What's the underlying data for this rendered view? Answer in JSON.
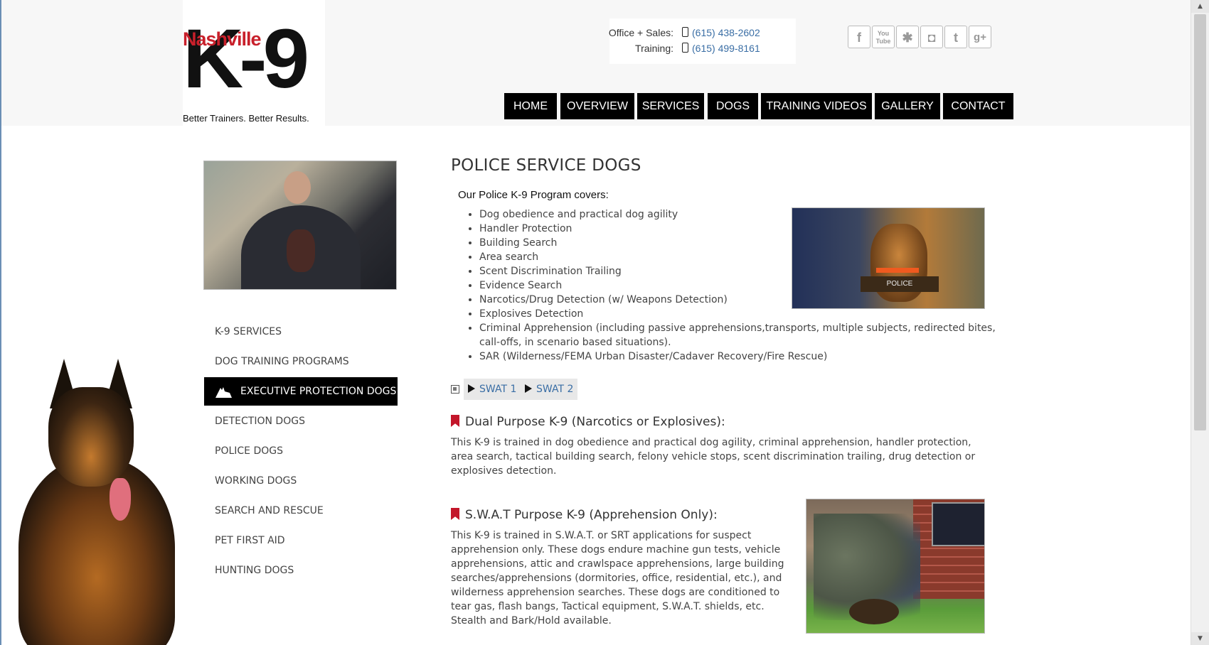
{
  "brand": {
    "name_top": "Nashville",
    "name_main": "K-9",
    "tagline": "Better Trainers. Better Results."
  },
  "contact": {
    "office_label": "Office + Sales:",
    "office_phone": "(615) 438-2602",
    "training_label": "Training:",
    "training_phone": "(615) 499-8161"
  },
  "social": [
    {
      "name": "facebook",
      "glyph": "f"
    },
    {
      "name": "youtube",
      "glyph": "You Tube"
    },
    {
      "name": "yelp",
      "glyph": "✱"
    },
    {
      "name": "instagram",
      "glyph": "◘"
    },
    {
      "name": "twitter",
      "glyph": "t"
    },
    {
      "name": "google-plus",
      "glyph": "g+"
    }
  ],
  "nav": [
    "HOME",
    "OVERVIEW",
    "SERVICES",
    "DOGS",
    "TRAINING VIDEOS",
    "GALLERY",
    "CONTACT"
  ],
  "sidenav": [
    "K-9 SERVICES",
    "DOG TRAINING PROGRAMS",
    "EXECUTIVE PROTECTION DOGS",
    "DETECTION DOGS",
    "POLICE DOGS",
    "WORKING DOGS",
    "SEARCH AND RESCUE",
    "PET FIRST AID",
    "HUNTING DOGS"
  ],
  "sidenav_active": "EXECUTIVE PROTECTION DOGS",
  "page": {
    "title": "POLICE SERVICE DOGS",
    "intro": "Our Police K-9 Program covers:",
    "program_items": [
      "Dog obedience and practical dog agility",
      "Handler Protection",
      "Building Search",
      "Area search",
      "Scent Discrimination Trailing",
      "Evidence Search",
      "Narcotics/Drug Detection (w/ Weapons Detection)",
      "Explosives Detection",
      "Criminal Apprehension (including passive apprehensions,transports, multiple subjects, redirected bites, call-offs, in scenario based situations).",
      "SAR (Wilderness/FEMA Urban Disaster/Cadaver Recovery/Fire Rescue)"
    ],
    "police_photo_vest": "POLICE",
    "videos": [
      "SWAT 1",
      "SWAT 2"
    ],
    "sections": [
      {
        "title": "Dual Purpose K-9 (Narcotics or Explosives):",
        "text": "This K-9 is trained in dog obedience and practical dog agility, criminal apprehension, handler protection, area search, tactical building search, felony vehicle stops, scent discrimination trailing, drug detection or explosives detection."
      },
      {
        "title": "S.W.A.T Purpose K-9 (Apprehension Only):",
        "text": "This K-9 is trained in S.W.A.T. or SRT applications for suspect apprehension only. These dogs endure machine gun tests, vehicle apprehensions, attic and crawlspace apprehensions, large building searches/apprehensions (dormitories, office, residential, etc.), and wilderness apprehension searches. These dogs are conditioned to tear gas, flash bangs, Tactical equipment, S.W.A.T. shields, etc. Stealth and Bark/Hold available."
      }
    ]
  },
  "colors": {
    "accent_red": "#c3162a",
    "link_blue": "#3a6ea5",
    "nav_bg": "#000000"
  }
}
